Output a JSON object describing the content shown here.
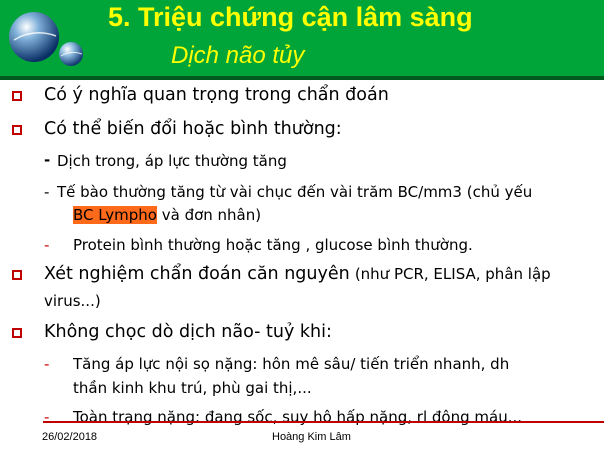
{
  "slide": {
    "title": "5. Triệu chứng cận lâm sàng",
    "subtitle": "Dịch não tủy",
    "bullets": [
      {
        "text": "Có ý nghĩa quan trọng trong chẩn đoán"
      },
      {
        "text": "Có thể biến đổi hoặc bình thường:"
      },
      {
        "text": "Xét nghiệm chẩn đoán căn nguyên",
        "note": "(như PCR, ELISA, phân lập",
        "line2": "virus...)"
      },
      {
        "text": "Không chọc dò dịch não- tuỷ khi:"
      }
    ],
    "sub_items_1": [
      {
        "dash": "-",
        "text": "Dịch trong, áp lực thường tăng"
      },
      {
        "dash": "-",
        "text": "Tế bào thường tăng từ vài chục đến vài trăm BC/mm3 (chủ yếu",
        "highlight": "BC Lympho",
        "rest": "và đơn nhân)"
      },
      {
        "dash": "-",
        "text": "Protein bình thường hoặc tăng , glucose bình thường."
      }
    ],
    "sub_items_2": [
      {
        "dash": "-",
        "text": "Tăng áp lực nội sọ nặng: hôn mê sâu/ tiến triển nhanh, dh",
        "line2": "thần kinh khu trú, phù gai thị,..."
      },
      {
        "dash": "-",
        "text": "Toàn trạng nặng: đang sốc, suy hô hấp nặng, rl đông máu..."
      }
    ]
  },
  "footer": {
    "date": "26/02/2018",
    "author": "Hoàng Kim Lâm"
  },
  "colors": {
    "header_bg": "#00a53a",
    "title": "#ffff00",
    "bullet_border": "#c00000",
    "highlight": "#ff6a1a"
  }
}
